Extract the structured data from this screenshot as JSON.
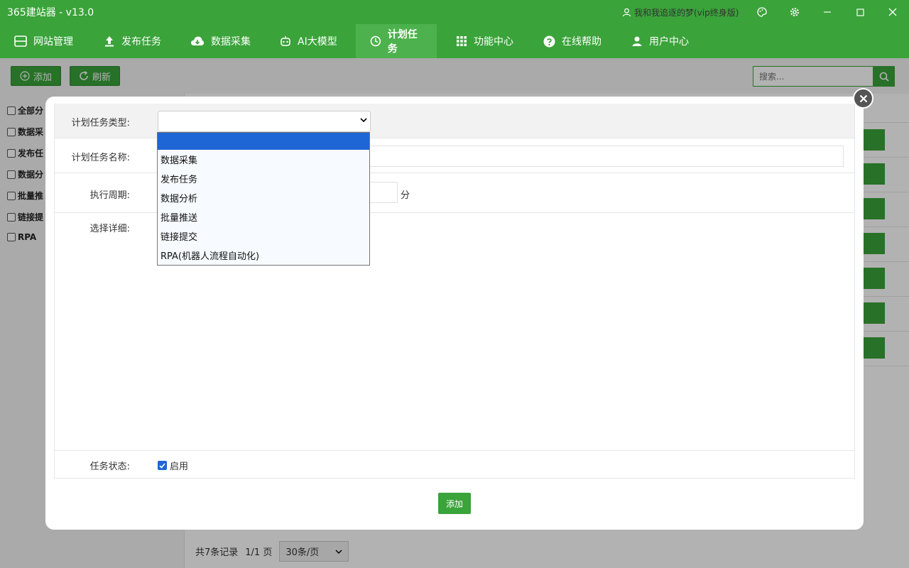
{
  "app": {
    "title": "365建站器 - v13.0",
    "user": "我和我追逐的梦(vip终身版)",
    "accent": "#3aa33a"
  },
  "nav": {
    "items": [
      {
        "label": "网站管理",
        "icon": "website-icon"
      },
      {
        "label": "发布任务",
        "icon": "upload-icon"
      },
      {
        "label": "数据采集",
        "icon": "cloud-download-icon"
      },
      {
        "label": "AI大模型",
        "icon": "robot-icon"
      },
      {
        "label": "计划任务",
        "icon": "clock-icon",
        "active": true
      },
      {
        "label": "功能中心",
        "icon": "grid-icon"
      },
      {
        "label": "在线帮助",
        "icon": "help-icon"
      },
      {
        "label": "用户中心",
        "icon": "user-icon"
      }
    ]
  },
  "toolbar": {
    "add_label": "添加",
    "refresh_label": "刷新",
    "search_placeholder": "搜索..."
  },
  "sidebar": {
    "categories": [
      "全部分",
      "数据采",
      "发布任",
      "数据分",
      "批量推",
      "链接提",
      "RPA"
    ]
  },
  "pager": {
    "total": "共7条记录",
    "pages": "1/1 页",
    "per_page": "30条/页"
  },
  "form": {
    "type_label": "计划任务类型:",
    "name_label": "计划任务名称:",
    "period_label": "执行周期:",
    "period_unit": "分",
    "detail_label": "选择详细:",
    "status_label": "任务状态:",
    "status_option": "启用",
    "status_checked": true,
    "submit_label": "添加"
  },
  "type_options": [
    "",
    "数据采集",
    "发布任务",
    "数据分析",
    "批量推送",
    "链接提交",
    "RPA(机器人流程自动化)"
  ]
}
